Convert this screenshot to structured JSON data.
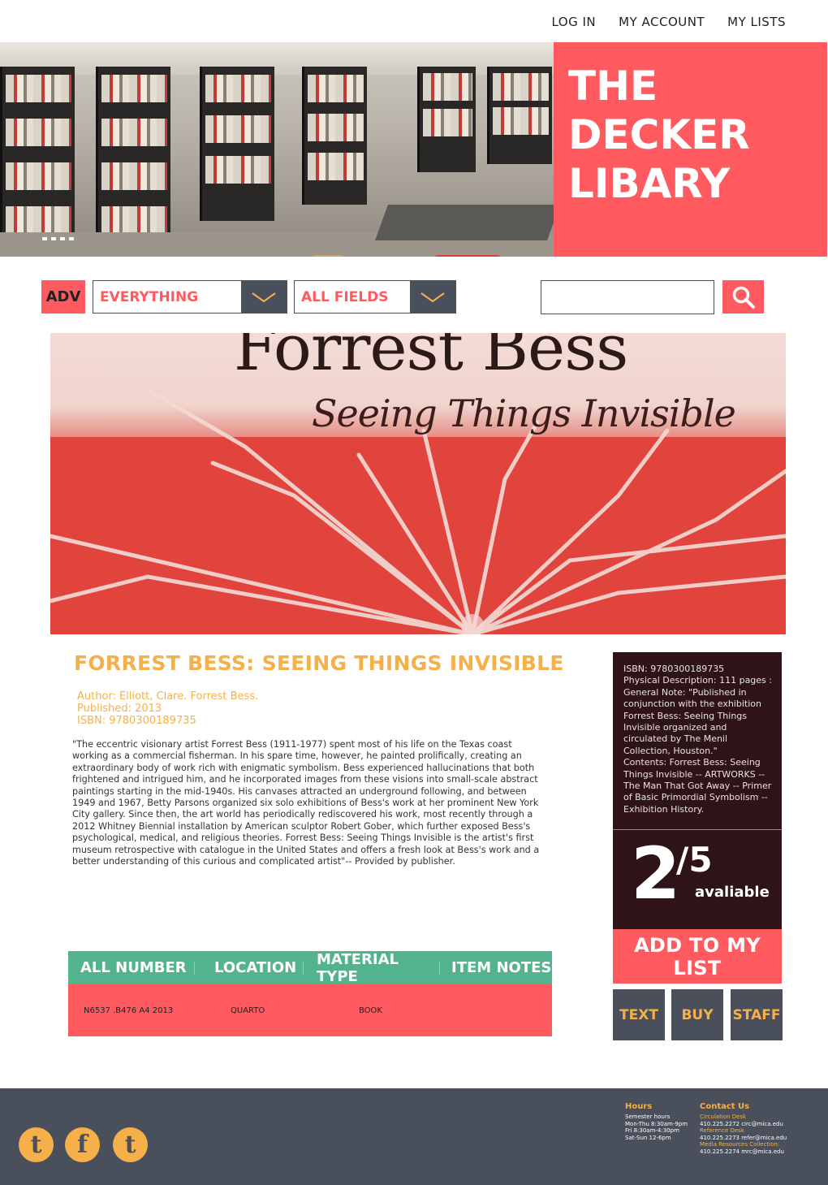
{
  "nav": {
    "login": "LOG IN",
    "account": "MY ACCOUNT",
    "lists": "MY LISTS"
  },
  "brand": {
    "title": "THE\nDECKER\nLIBARY",
    "color": "#ff5a5f"
  },
  "search": {
    "adv_label": "ADV",
    "scope_value": "EVERYTHING",
    "field_value": "ALL FIELDS",
    "query_value": "",
    "search_icon": "search-icon"
  },
  "cover": {
    "title": "Forrest Bess",
    "subtitle": "Seeing Things Invisible"
  },
  "book": {
    "title": "FORREST BESS: SEEING THINGS INVISIBLE",
    "author": "Author: Elliott, Clare. Forrest Bess.",
    "published": "Published: 2013",
    "isbn": "ISBN: 9780300189735",
    "description": "\"The eccentric visionary artist Forrest Bess (1911-1977) spent most of his life on the Texas coast working as a commercial fisherman. In his spare time, however, he painted prolifically, creating an extraordinary body of work rich with enigmatic symbolism. Bess experienced hallucinations that both frightened and intrigued him, and he incorporated images from these visions into small-scale abstract paintings starting in the mid-1940s. His canvases attracted an underground following, and between 1949 and 1967, Betty Parsons organized six solo exhibitions of Bess's work at her prominent New York City gallery. Since then, the art world has periodically rediscovered his work, most recently through a 2012 Whitney Biennial installation by American sculptor Robert Gober, which further exposed Bess's psychological, medical, and religious theories. Forrest Bess: Seeing Things Invisible is the artist's first museum retrospective with catalogue in the United States and offers a fresh look at Bess's work and a better understanding of this curious and complicated artist\"-- Provided by publisher."
  },
  "side": {
    "isbn": "ISBN: 9780300189735",
    "physical": "Physical Description: 111 pages :",
    "note": "General Note: \"Published in conjunction with the exhibition Forrest Bess: Seeing Things Invisible organized and circulated by The Menil Collection, Houston.\"",
    "contents": "Contents: Forrest Bess: Seeing Things Invisible -- ARTWORKS -- The Man That Got Away -- Primer of Basic Primordial Symbolism -- Exhibition History."
  },
  "availability": {
    "available": "2",
    "total": "5",
    "label": "avaliable"
  },
  "actions": {
    "add": "ADD TO MY LIST",
    "text": "TEXT",
    "buy": "BUY",
    "staff": "STAFF"
  },
  "holdings": {
    "headers": [
      "ALL NUMBER",
      "LOCATION",
      "MATERIAL TYPE",
      "ITEM NOTES"
    ],
    "rows": [
      [
        "N6537 .B476 A4 2013",
        "QUARTO",
        "BOOK",
        ""
      ]
    ]
  },
  "footer": {
    "social": [
      "tumblr-icon",
      "facebook-icon",
      "twitter-icon"
    ],
    "hours_title": "Hours",
    "hours": [
      "Semester hours",
      "Mon-Thu 8:30am-9pm",
      "Fri 8:30am-4:30pm",
      "Sat-Sun 12-6pm"
    ],
    "contact_title": "Contact Us",
    "contact": {
      "circ_label": "Circulation Desk",
      "circ": "410.225.2272 circ@mica.edu",
      "ref_label": "Reference Desk",
      "ref": "410.225.2273 refer@mica.edu",
      "media_label": "Media Resources Collection:",
      "media": "410.225.2274 mrc@mica.edu"
    }
  }
}
